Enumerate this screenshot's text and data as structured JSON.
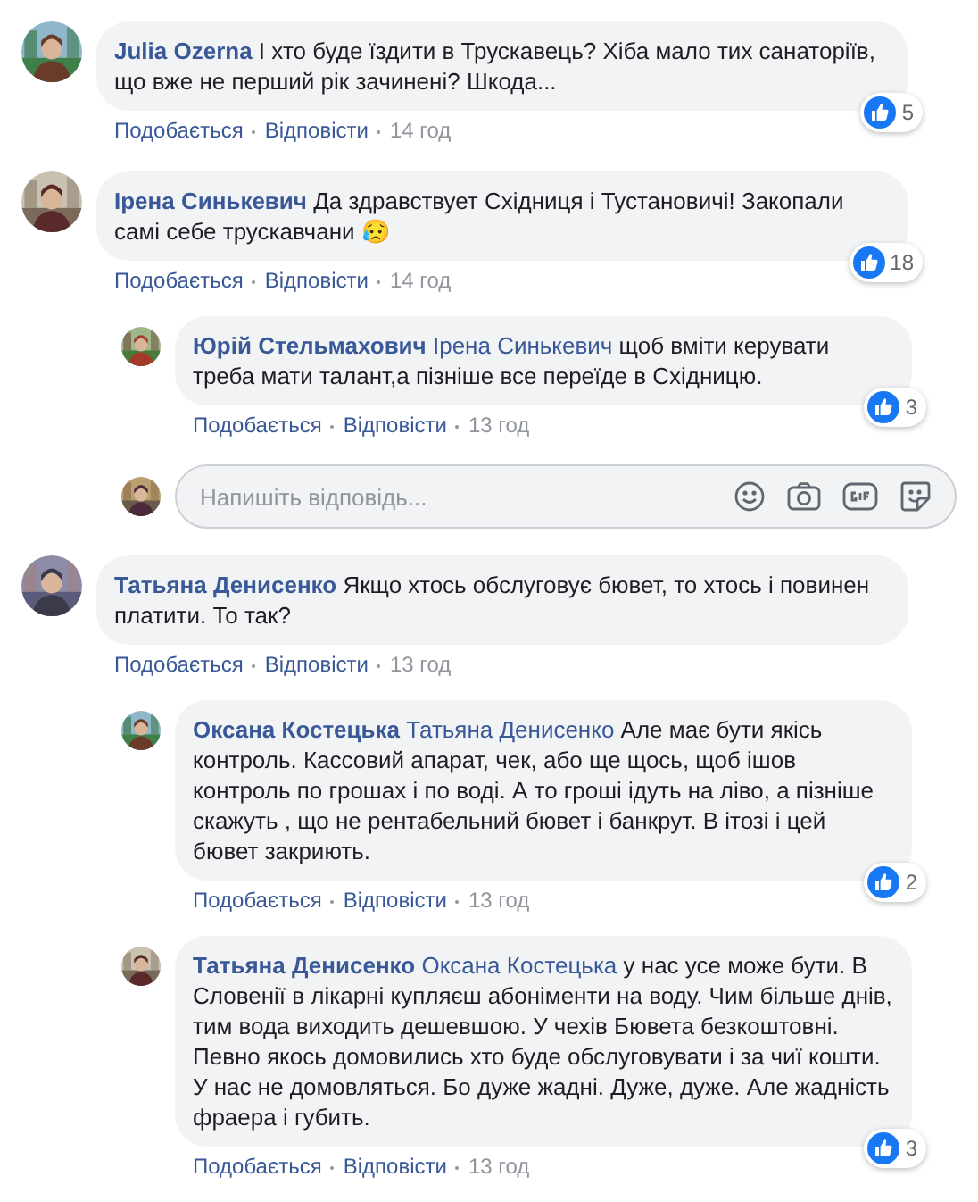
{
  "comments": [
    {
      "author": "Julia Ozerna",
      "text": "І хто буде їздити в Трускавець? Хіба мало тих санаторіїв, що вже не перший рік зачинені? Шкода...",
      "likes": "5",
      "like_label": "Подобається",
      "reply_label": "Відповісти",
      "time": "14 год"
    },
    {
      "author": "Ірена Синькевич",
      "text": "Да здравствует Східниця і Тустановичі! Закопали самі себе трускавчани 😥",
      "likes": "18",
      "like_label": "Подобається",
      "reply_label": "Відповісти",
      "time": "14 год",
      "replies": [
        {
          "author": "Юрій Стельмахович",
          "mention": "Ірена Синькевич",
          "text": "щоб вміти керувати треба мати талант,а пізніше все переїде в Східницю.",
          "likes": "3",
          "like_label": "Подобається",
          "reply_label": "Відповісти",
          "time": "13 год"
        }
      ],
      "reply_box": {
        "placeholder": "Напишіть відповідь..."
      }
    },
    {
      "author": "Татьяна Денисенко",
      "text": "Якщо хтось обслуговує бювет, то хтось і повинен платити. То так?",
      "like_label": "Подобається",
      "reply_label": "Відповісти",
      "time": "13 год",
      "replies": [
        {
          "author": "Оксана Костецька",
          "mention": "Татьяна Денисенко",
          "text": "Але має бути якісь контроль. Кассовий апарат, чек, або ще щось, щоб ішов контроль по грошах і по воді. А то гроші ідуть на ліво, а пізніше скажуть , що не рентабельний бювет і банкрут. В ітозі і цей бювет закриють.",
          "likes": "2",
          "like_label": "Подобається",
          "reply_label": "Відповісти",
          "time": "13 год"
        },
        {
          "author": "Татьяна Денисенко",
          "mention": "Оксана Костецька",
          "text": "у нас усе може бути. В Словенії в лікарні купляєш абоніменти на воду. Чим більше днів, тим вода виходить дешевшою. У чехів Бювета безкоштовні. Певно якось домовились хто буде обслуговувати і за чиї кошти. У нас не домовляться. Бо дуже жадні. Дуже, дуже. Але жадність фраера і губить.",
          "likes": "3",
          "like_label": "Подобається",
          "reply_label": "Відповісти",
          "time": "13 год"
        }
      ]
    }
  ]
}
